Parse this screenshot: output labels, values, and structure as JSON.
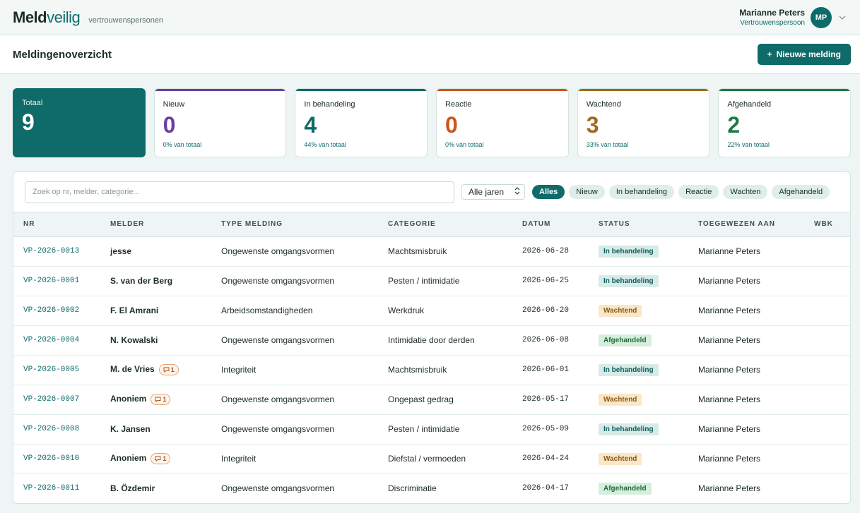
{
  "app": {
    "logo_a": "Meld",
    "logo_b": "veilig",
    "subtitle": "vertrouwenspersonen"
  },
  "user": {
    "name": "Marianne Peters",
    "role": "Vertrouwenspersoon",
    "initials": "MP"
  },
  "page": {
    "title": "Meldingenoverzicht",
    "new_button": "Nieuwe melding"
  },
  "stats": [
    {
      "label": "Totaal",
      "value": "9",
      "sub": "",
      "color": "#0f6b69"
    },
    {
      "label": "Nieuw",
      "value": "0",
      "sub": "0% van totaal",
      "color": "#6b3fa0"
    },
    {
      "label": "In behandeling",
      "value": "4",
      "sub": "44% van totaal",
      "color": "#0f6b69"
    },
    {
      "label": "Reactie",
      "value": "0",
      "sub": "0% van totaal",
      "color": "#c9571a"
    },
    {
      "label": "Wachtend",
      "value": "3",
      "sub": "33% van totaal",
      "color": "#a06a1e"
    },
    {
      "label": "Afgehandeld",
      "value": "2",
      "sub": "22% van totaal",
      "color": "#1e7a46"
    }
  ],
  "filters": {
    "search_placeholder": "Zoek op nr, melder, categorie...",
    "year_select": "Alle jaren",
    "pills": [
      "Alles",
      "Nieuw",
      "In behandeling",
      "Reactie",
      "Wachten",
      "Afgehandeld"
    ]
  },
  "table": {
    "headers": [
      "NR",
      "MELDER",
      "TYPE MELDING",
      "CATEGORIE",
      "DATUM",
      "STATUS",
      "TOEGEWEZEN AAN",
      "WBK"
    ],
    "rows": [
      {
        "nr": "VP-2026-0013",
        "melder": "jesse",
        "comments": "",
        "type": "Ongewenste omgangsvormen",
        "categorie": "Machtsmisbruik",
        "datum": "2026-06-28",
        "status": "In behandeling",
        "status_key": "behandeling",
        "toegewezen": "Marianne Peters",
        "wbk": ""
      },
      {
        "nr": "VP-2026-0001",
        "melder": "S. van der Berg",
        "comments": "",
        "type": "Ongewenste omgangsvormen",
        "categorie": "Pesten / intimidatie",
        "datum": "2026-06-25",
        "status": "In behandeling",
        "status_key": "behandeling",
        "toegewezen": "Marianne Peters",
        "wbk": ""
      },
      {
        "nr": "VP-2026-0002",
        "melder": "F. El Amrani",
        "comments": "",
        "type": "Arbeidsomstandigheden",
        "categorie": "Werkdruk",
        "datum": "2026-06-20",
        "status": "Wachtend",
        "status_key": "wachtend",
        "toegewezen": "Marianne Peters",
        "wbk": ""
      },
      {
        "nr": "VP-2026-0004",
        "melder": "N. Kowalski",
        "comments": "",
        "type": "Ongewenste omgangsvormen",
        "categorie": "Intimidatie door derden",
        "datum": "2026-06-08",
        "status": "Afgehandeld",
        "status_key": "afgehandeld",
        "toegewezen": "Marianne Peters",
        "wbk": ""
      },
      {
        "nr": "VP-2026-0005",
        "melder": "M. de Vries",
        "comments": "1",
        "type": "Integriteit",
        "categorie": "Machtsmisbruik",
        "datum": "2026-06-01",
        "status": "In behandeling",
        "status_key": "behandeling",
        "toegewezen": "Marianne Peters",
        "wbk": ""
      },
      {
        "nr": "VP-2026-0007",
        "melder": "Anoniem",
        "comments": "1",
        "type": "Ongewenste omgangsvormen",
        "categorie": "Ongepast gedrag",
        "datum": "2026-05-17",
        "status": "Wachtend",
        "status_key": "wachtend",
        "toegewezen": "Marianne Peters",
        "wbk": ""
      },
      {
        "nr": "VP-2026-0008",
        "melder": "K. Jansen",
        "comments": "",
        "type": "Ongewenste omgangsvormen",
        "categorie": "Pesten / intimidatie",
        "datum": "2026-05-09",
        "status": "In behandeling",
        "status_key": "behandeling",
        "toegewezen": "Marianne Peters",
        "wbk": ""
      },
      {
        "nr": "VP-2026-0010",
        "melder": "Anoniem",
        "comments": "1",
        "type": "Integriteit",
        "categorie": "Diefstal / vermoeden",
        "datum": "2026-04-24",
        "status": "Wachtend",
        "status_key": "wachtend",
        "toegewezen": "Marianne Peters",
        "wbk": ""
      },
      {
        "nr": "VP-2026-0011",
        "melder": "B. Özdemir",
        "comments": "",
        "type": "Ongewenste omgangsvormen",
        "categorie": "Discriminatie",
        "datum": "2026-04-17",
        "status": "Afgehandeld",
        "status_key": "afgehandeld",
        "toegewezen": "Marianne Peters",
        "wbk": ""
      }
    ]
  }
}
